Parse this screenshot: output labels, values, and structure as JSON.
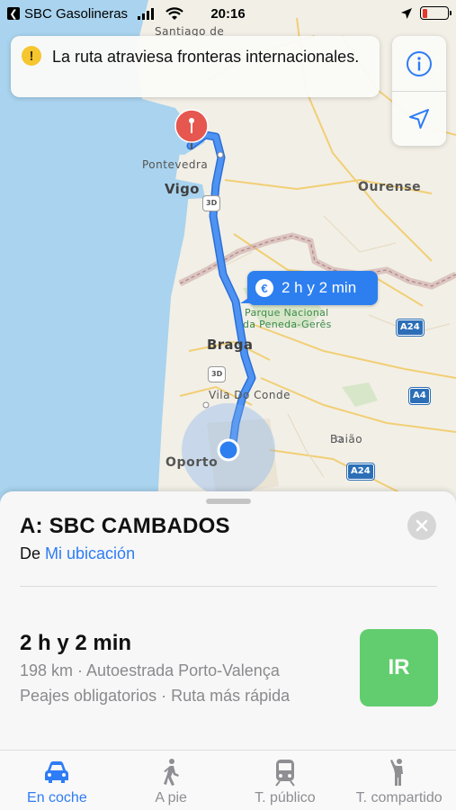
{
  "status_bar": {
    "back_app": "SBC Gasolineras",
    "time": "20:16"
  },
  "alert": {
    "icon": "warning-icon",
    "text": "La ruta atraviesa fronteras internacionales."
  },
  "map_controls": {
    "info_icon": "info-icon",
    "location_icon": "location-arrow-icon"
  },
  "map": {
    "labels": {
      "santiago": "Santiago de",
      "pontevedra": "Pontevedra",
      "vigo": "Vigo",
      "ourense": "Ourense",
      "park_line1": "Parque Nacional",
      "park_line2": "da Peneda-Gerês",
      "braga": "Braga",
      "vila_do_conde": "Vila Do Conde",
      "baiao": "Baião",
      "oporto": "Oporto"
    },
    "shields": {
      "a24_upper": "A24",
      "a4": "A4",
      "a24_lower": "A24",
      "badge_3d_upper": "3D",
      "badge_3d_lower": "3D"
    },
    "route_bubble": {
      "icon": "euro-icon",
      "text": "2 h y 2 min"
    },
    "colors": {
      "route": "#3f86ea",
      "water": "#a9d3ee",
      "land": "#f2efe6",
      "destination_pin": "#e5574f"
    }
  },
  "sheet": {
    "title": "A: SBC CAMBADOS",
    "from_prefix": "De",
    "from_link": "Mi ubicación",
    "route": {
      "duration": "2 h y 2 min",
      "detail1": "198 km · Autoestrada Porto-Valença",
      "detail2": "Peajes obligatorios · Ruta más rápida",
      "go_label": "IR"
    },
    "close_icon": "close-icon",
    "go_color": "#62cd6f"
  },
  "tabs": [
    {
      "label": "En coche",
      "icon": "car-icon",
      "active": true
    },
    {
      "label": "A pie",
      "icon": "walk-icon",
      "active": false
    },
    {
      "label": "T. público",
      "icon": "train-icon",
      "active": false
    },
    {
      "label": "T. compartido",
      "icon": "rideshare-icon",
      "active": false
    }
  ]
}
